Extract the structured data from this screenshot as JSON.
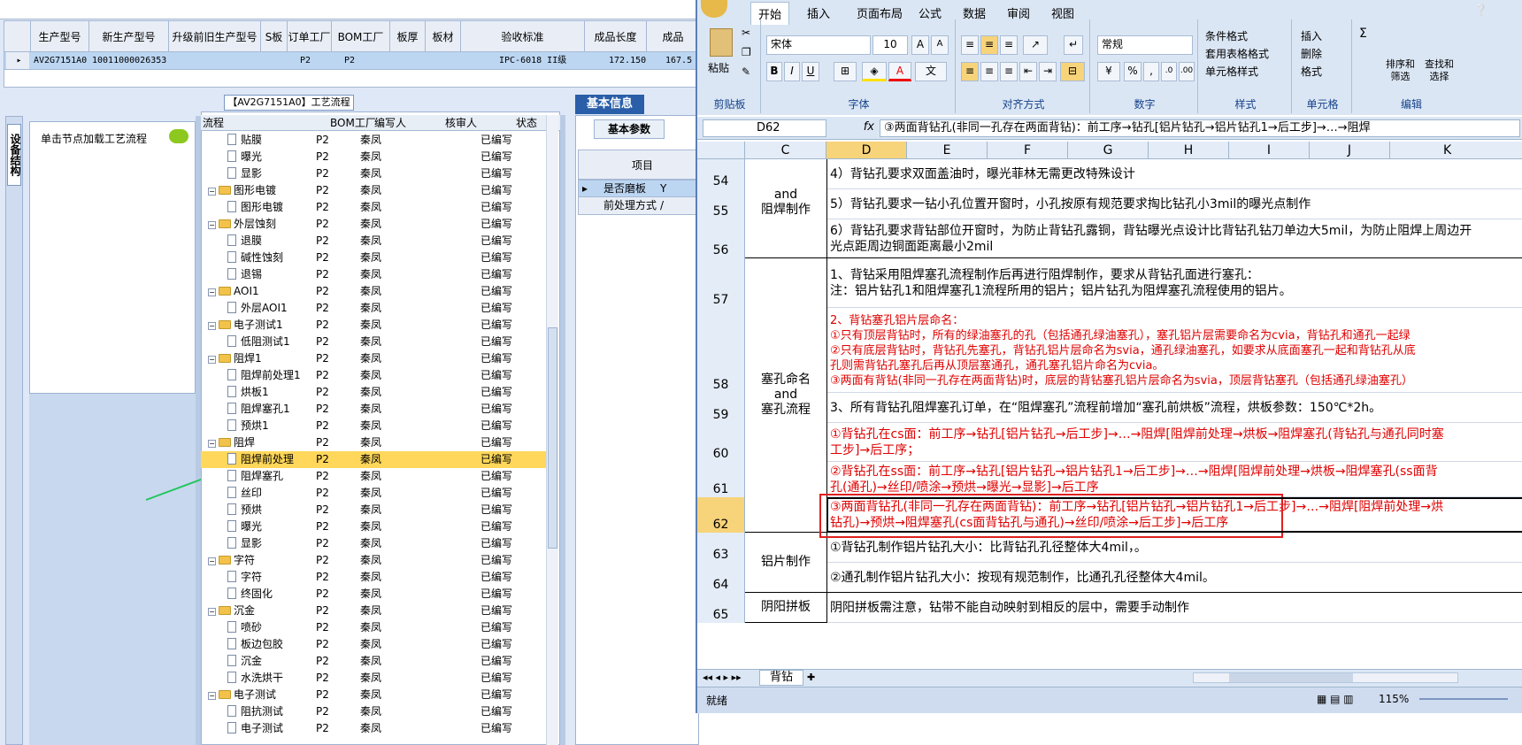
{
  "grid": {
    "headers": [
      "生产型号",
      "新生产型号",
      "升级前旧生产型号",
      "S板",
      "订单工厂",
      "BOM工厂",
      "板厚",
      "板材",
      "验收标准",
      "成品长度",
      "成品"
    ],
    "row": [
      "AV2G7151A0",
      "10011000026353",
      "",
      "",
      "P2",
      "P2",
      "",
      "",
      "IPC-6018 II级",
      "172.150",
      "167.5"
    ]
  },
  "left_panel": {
    "vertical_tab": "设备结构",
    "hint": "单击节点加载工艺流程"
  },
  "workflow": {
    "title": "【AV2G7151A0】工艺流程",
    "columns": [
      "流程",
      "BOM工厂",
      "编写人",
      "核审人",
      "状态"
    ],
    "rows": [
      {
        "name": "贴膜",
        "level": 2,
        "factory": "P2",
        "writer": "秦凤",
        "status": "已编写"
      },
      {
        "name": "曝光",
        "level": 2,
        "factory": "P2",
        "writer": "秦凤",
        "status": "已编写"
      },
      {
        "name": "显影",
        "level": 2,
        "factory": "P2",
        "writer": "秦凤",
        "status": "已编写"
      },
      {
        "name": "图形电镀",
        "level": 1,
        "factory": "P2",
        "writer": "秦凤",
        "status": "已编写"
      },
      {
        "name": "图形电镀",
        "level": 2,
        "factory": "P2",
        "writer": "秦凤",
        "status": "已编写"
      },
      {
        "name": "外层蚀刻",
        "level": 1,
        "factory": "P2",
        "writer": "秦凤",
        "status": "已编写"
      },
      {
        "name": "退膜",
        "level": 2,
        "factory": "P2",
        "writer": "秦凤",
        "status": "已编写"
      },
      {
        "name": "碱性蚀刻",
        "level": 2,
        "factory": "P2",
        "writer": "秦凤",
        "status": "已编写"
      },
      {
        "name": "退锡",
        "level": 2,
        "factory": "P2",
        "writer": "秦凤",
        "status": "已编写"
      },
      {
        "name": "AOI1",
        "level": 1,
        "factory": "P2",
        "writer": "秦凤",
        "status": "已编写"
      },
      {
        "name": "外层AOI1",
        "level": 2,
        "factory": "P2",
        "writer": "秦凤",
        "status": "已编写"
      },
      {
        "name": "电子测试1",
        "level": 1,
        "factory": "P2",
        "writer": "秦凤",
        "status": "已编写"
      },
      {
        "name": "低阻测试1",
        "level": 2,
        "factory": "P2",
        "writer": "秦凤",
        "status": "已编写"
      },
      {
        "name": "阻焊1",
        "level": 1,
        "factory": "P2",
        "writer": "秦凤",
        "status": "已编写"
      },
      {
        "name": "阻焊前处理1",
        "level": 2,
        "factory": "P2",
        "writer": "秦凤",
        "status": "已编写"
      },
      {
        "name": "烘板1",
        "level": 2,
        "factory": "P2",
        "writer": "秦凤",
        "status": "已编写"
      },
      {
        "name": "阻焊塞孔1",
        "level": 2,
        "factory": "P2",
        "writer": "秦凤",
        "status": "已编写"
      },
      {
        "name": "预烘1",
        "level": 2,
        "factory": "P2",
        "writer": "秦凤",
        "status": "已编写"
      },
      {
        "name": "阻焊",
        "level": 1,
        "factory": "P2",
        "writer": "秦凤",
        "status": "已编写"
      },
      {
        "name": "阻焊前处理",
        "level": 2,
        "factory": "P2",
        "writer": "秦凤",
        "status": "已编写",
        "selected": true
      },
      {
        "name": "阻焊塞孔",
        "level": 2,
        "factory": "P2",
        "writer": "秦凤",
        "status": "已编写"
      },
      {
        "name": "丝印",
        "level": 2,
        "factory": "P2",
        "writer": "秦凤",
        "status": "已编写"
      },
      {
        "name": "预烘",
        "level": 2,
        "factory": "P2",
        "writer": "秦凤",
        "status": "已编写"
      },
      {
        "name": "曝光",
        "level": 2,
        "factory": "P2",
        "writer": "秦凤",
        "status": "已编写"
      },
      {
        "name": "显影",
        "level": 2,
        "factory": "P2",
        "writer": "秦凤",
        "status": "已编写"
      },
      {
        "name": "字符",
        "level": 1,
        "factory": "P2",
        "writer": "秦凤",
        "status": "已编写"
      },
      {
        "name": "字符",
        "level": 2,
        "factory": "P2",
        "writer": "秦凤",
        "status": "已编写"
      },
      {
        "name": "终固化",
        "level": 2,
        "factory": "P2",
        "writer": "秦凤",
        "status": "已编写"
      },
      {
        "name": "沉金",
        "level": 1,
        "factory": "P2",
        "writer": "秦凤",
        "status": "已编写"
      },
      {
        "name": "喷砂",
        "level": 2,
        "factory": "P2",
        "writer": "秦凤",
        "status": "已编写"
      },
      {
        "name": "板边包胶",
        "level": 2,
        "factory": "P2",
        "writer": "秦凤",
        "status": "已编写"
      },
      {
        "name": "沉金",
        "level": 2,
        "factory": "P2",
        "writer": "秦凤",
        "status": "已编写"
      },
      {
        "name": "水洗烘干",
        "level": 2,
        "factory": "P2",
        "writer": "秦凤",
        "status": "已编写"
      },
      {
        "name": "电子测试",
        "level": 1,
        "factory": "P2",
        "writer": "秦凤",
        "status": "已编写"
      },
      {
        "name": "阻抗测试",
        "level": 2,
        "factory": "P2",
        "writer": "秦凤",
        "status": "已编写"
      },
      {
        "name": "电子测试",
        "level": 2,
        "factory": "P2",
        "writer": "秦凤",
        "status": "已编写"
      }
    ]
  },
  "basic_info": {
    "title": "基本信息",
    "tab": "基本参数",
    "col_header": "项目",
    "rows": [
      [
        "是否磨板",
        "Y"
      ],
      [
        "前处理方式",
        "/"
      ]
    ]
  },
  "excel": {
    "tabs": [
      "开始",
      "插入",
      "页面布局",
      "公式",
      "数据",
      "审阅",
      "视图"
    ],
    "paste": "粘贴",
    "clipboard_label": "剪贴板",
    "font_name": "宋体",
    "font_size": "10",
    "font_label": "字体",
    "align_label": "对齐方式",
    "number_format": "常规",
    "number_label": "数字",
    "cond_format": "条件格式",
    "table_format": "套用表格格式",
    "cell_style": "单元格样式",
    "style_label": "样式",
    "insert": "插入",
    "delete": "删除",
    "format": "格式",
    "cells_label": "单元格",
    "sort_filter": "排序和\n筛选",
    "find_select": "查找和\n选择",
    "edit_label": "编辑",
    "name_box": "D62",
    "formula": "③两面背钻孔(非同一孔存在两面背钻)：前工序→钻孔[铝片钻孔→铝片钻孔1→后工步]→…→阻焊",
    "columns": [
      "C",
      "D",
      "E",
      "F",
      "G",
      "H",
      "I",
      "J",
      "K"
    ],
    "rows": [
      {
        "num": "54",
        "c": "",
        "d": "4）背钻孔要求双面盖油时，曝光菲林无需更改特殊设计",
        "red": false
      },
      {
        "num": "55",
        "c": "",
        "d": "5）背钻孔要求一钻小孔位置开窗时，小孔按原有规范要求掏比钻孔小3mil的曝光点制作",
        "red": false
      },
      {
        "num": "56",
        "c": "",
        "d": "6）背钻孔要求背钻部位开窗时，为防止背钻孔露铜，背钻曝光点设计比背钻孔钻刀单边大5mil，为防止阻焊上周边开",
        "d2": "光点距周边铜面距离最小2mil",
        "red": false
      },
      {
        "num": "57",
        "c": "",
        "d": "1、背钻采用阻焊塞孔流程制作后再进行阻焊制作，要求从背钻孔面进行塞孔：",
        "d2": "    注：铝片钻孔1和阻焊塞孔1流程所用的铝片；铝片钻孔为阻焊塞孔流程使用的铝片。",
        "red": false
      },
      {
        "num": "58",
        "c": "",
        "d": "2、背钻塞孔铝片层命名：",
        "d2": "①只有顶层背钻时，所有的绿油塞孔的孔（包括通孔绿油塞孔），塞孔铝片层需要命名为cvia，背钻孔和通孔一起绿",
        "d3": "②只有底层背钻时，背钻孔先塞孔，背钻孔铝片层命名为svia，通孔绿油塞孔，如要求从底面塞孔一起和背钻孔从底",
        "d4": "孔则需背钻孔塞孔后再从顶层塞通孔，通孔塞孔铝片命名为cvia。",
        "d5": "③两面有背钻(非同一孔存在两面背钻)时，底层的背钻塞孔铝片层命名为svia，顶层背钻塞孔（包括通孔绿油塞孔）",
        "red": true
      },
      {
        "num": "59",
        "c": "",
        "d": "3、所有背钻孔阻焊塞孔订单，在“阻焊塞孔”流程前增加“塞孔前烘板”流程，烘板参数：150℃*2h。",
        "red": false
      },
      {
        "num": "60",
        "c": "",
        "d": "①背钻孔在cs面：前工序→钻孔[铝片钻孔→后工步]→…→阻焊[阻焊前处理→烘板→阻焊塞孔(背钻孔与通孔同时塞",
        "d2": "工步]→后工序；",
        "red": true
      },
      {
        "num": "61",
        "c": "",
        "d": "②背钻孔在ss面：前工序→钻孔[铝片钻孔→铝片钻孔1→后工步]→…→阻焊[阻焊前处理→烘板→阻焊塞孔(ss面背",
        "d2": "孔(通孔)→丝印/喷涂→预烘→曝光→显影]→后工序",
        "red": true
      },
      {
        "num": "62",
        "c": "",
        "d": "③两面背钻孔(非同一孔存在两面背钻)：前工序→钻孔[铝片钻孔→铝片钻孔1→后工步]→…→阻焊[阻焊前处理→烘",
        "d2": "钻孔)→预烘→阻焊塞孔(cs面背钻孔与通孔)→丝印/喷涂→后工步]→后工序",
        "red": true
      },
      {
        "num": "63",
        "c": "",
        "d": "①背钻孔制作铝片钻孔大小：比背钻孔孔径整体大4mil，。",
        "red": false
      },
      {
        "num": "64",
        "c": "",
        "d": "②通孔制作铝片钻孔大小：按现有规范制作，比通孔孔径整体大4mil。",
        "red": false
      },
      {
        "num": "65",
        "c": "",
        "d": "阴阳拼板需注意，钻带不能自动映射到相反的层中，需要手动制作",
        "red": false
      }
    ],
    "c_labels": {
      "top": "and\n阻焊制作",
      "mid": "塞孔命名\nand\n塞孔流程",
      "lower": "铝片制作",
      "last": "阴阳拼板"
    },
    "sheet_tab": "背钻",
    "status": "就绪",
    "zoom": "115%"
  }
}
